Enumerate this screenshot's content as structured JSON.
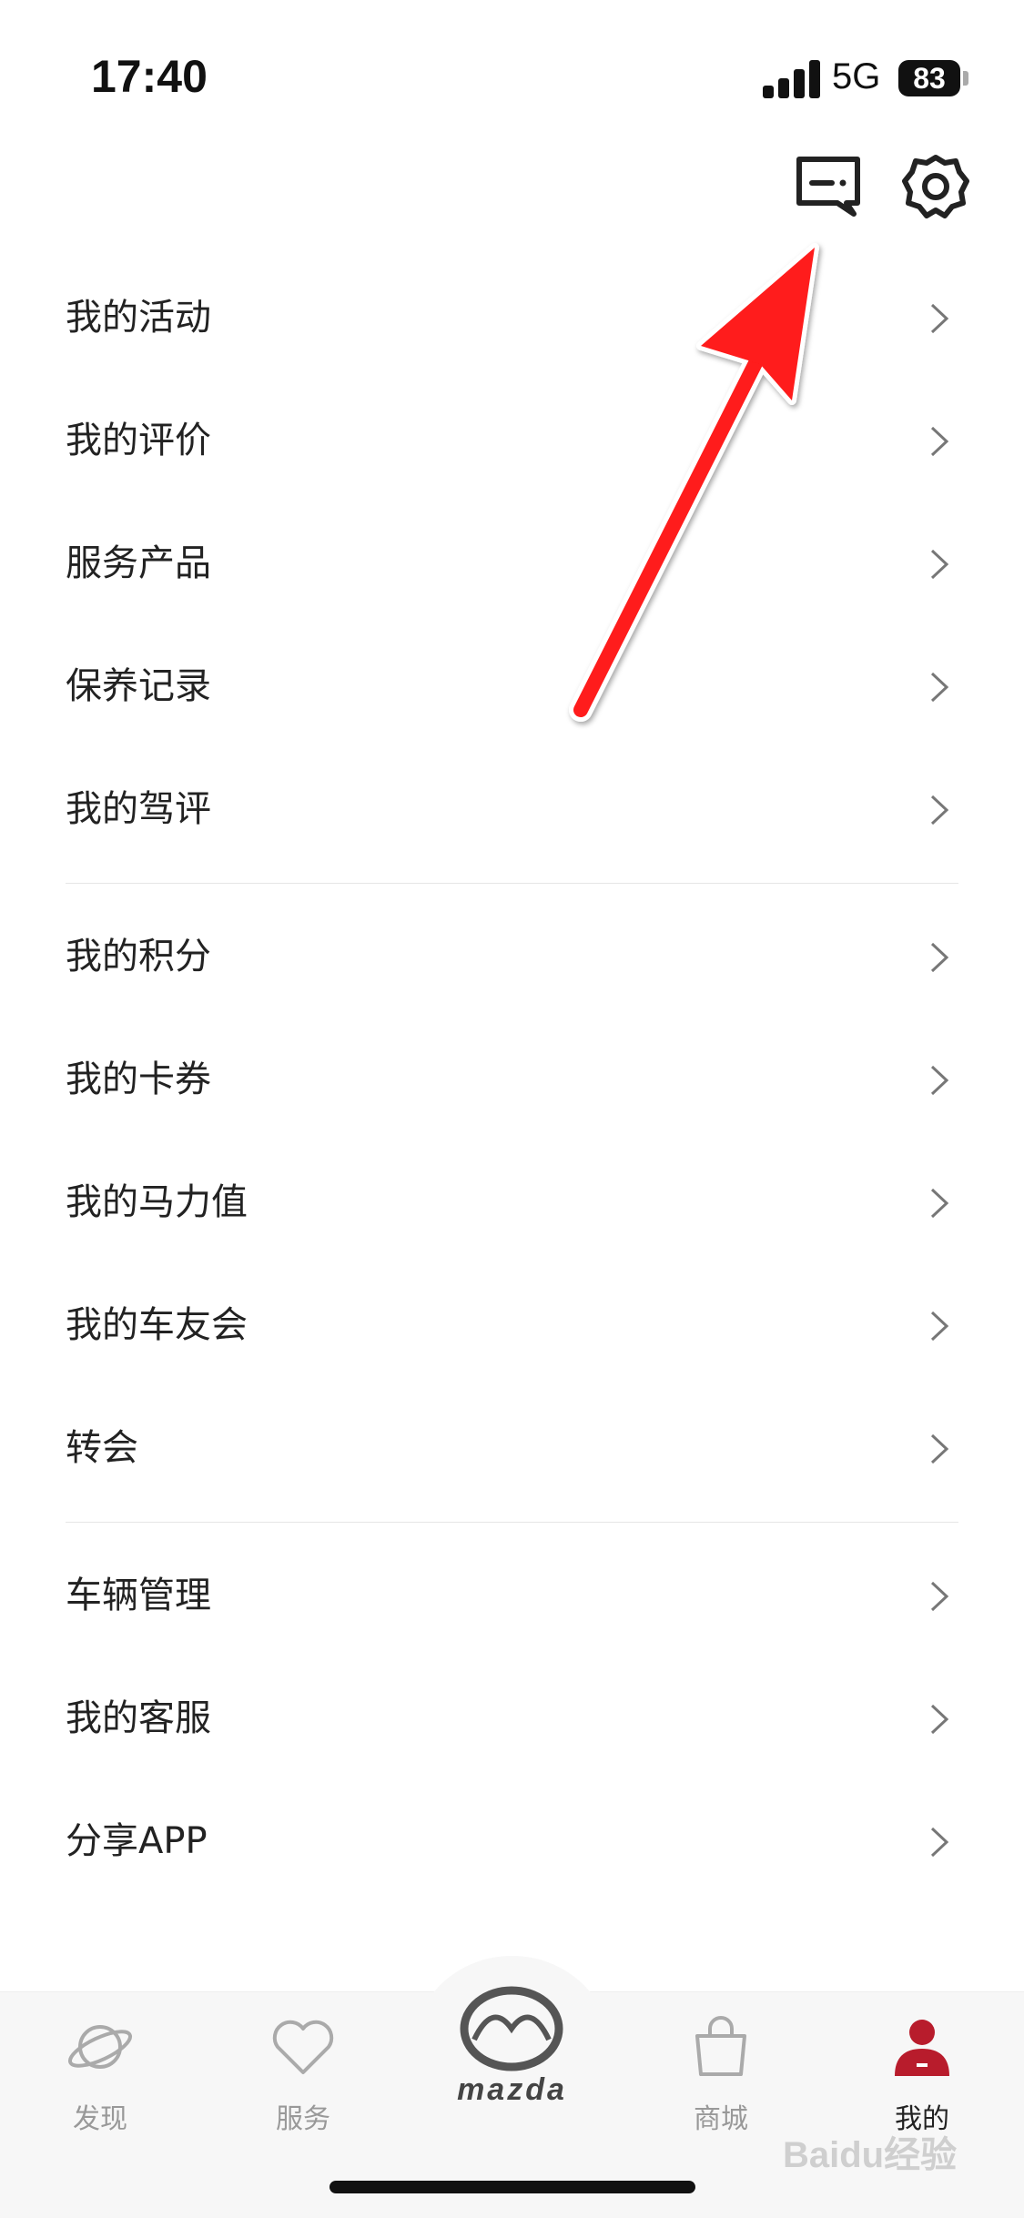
{
  "status_bar": {
    "time": "17:40",
    "network": "5G",
    "battery": "83"
  },
  "header": {
    "message_icon": "message-icon",
    "settings_icon": "gear-icon"
  },
  "menu": {
    "group1": [
      {
        "label": "我的活动"
      },
      {
        "label": "我的评价"
      },
      {
        "label": "服务产品"
      },
      {
        "label": "保养记录"
      },
      {
        "label": "我的驾评"
      }
    ],
    "group2": [
      {
        "label": "我的积分"
      },
      {
        "label": "我的卡券"
      },
      {
        "label": "我的马力值"
      },
      {
        "label": "我的车友会"
      },
      {
        "label": "转会"
      }
    ],
    "group3": [
      {
        "label": "车辆管理"
      },
      {
        "label": "我的客服"
      },
      {
        "label": "分享APP"
      }
    ]
  },
  "bottom_nav": {
    "discover": "发现",
    "service": "服务",
    "logo_text": "mazda",
    "mall": "商城",
    "mine": "我的"
  },
  "watermark": "Baidu经验",
  "colors": {
    "active": "#b81c2c",
    "annotation": "#ff1a1a"
  }
}
